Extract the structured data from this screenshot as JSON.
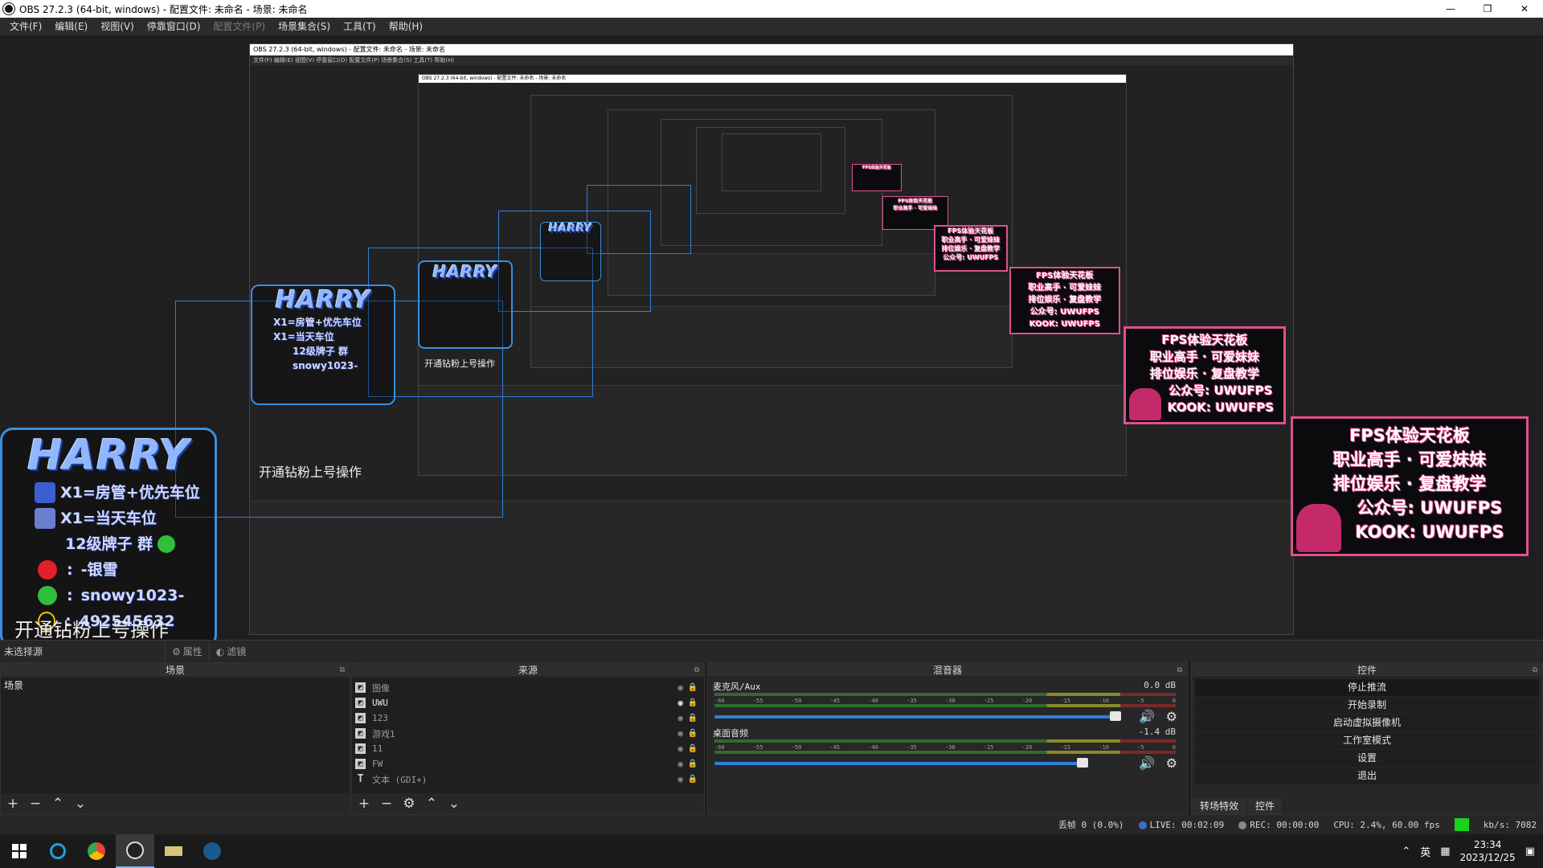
{
  "window": {
    "title": "OBS 27.2.3 (64-bit, windows) - 配置文件: 未命名 - 场景: 未命名",
    "minimize": "—",
    "maximize": "❐",
    "close": "✕"
  },
  "menu": [
    "文件(F)",
    "编辑(E)",
    "视图(V)",
    "停靠窗口(D)",
    "配置文件(P)",
    "场景集合(S)",
    "工具(T)",
    "帮助(H)"
  ],
  "overlay": {
    "logo": "HARRY",
    "rows": [
      "X1=房管+优先车位",
      "X1=当天车位",
      "12级牌子 群",
      "-银雪",
      "snowy1023-",
      "492545632"
    ],
    "caption": "开通钻粉上号操作"
  },
  "banner": {
    "lines": [
      "FPS体验天花板",
      "职业高手 · 可爱妹妹",
      "排位娱乐 · 复盘教学",
      "公众号: UWUFPS",
      "KOOK: UWUFPS"
    ]
  },
  "source_bar": {
    "no_source": "未选择源",
    "properties": "属性",
    "filters": "滤镜"
  },
  "scenes": {
    "title": "场景",
    "items": [
      "场景"
    ]
  },
  "sources": {
    "title": "来源",
    "items": [
      {
        "name": "图像",
        "type": "image"
      },
      {
        "name": "UWU",
        "type": "image"
      },
      {
        "name": "123",
        "type": "image"
      },
      {
        "name": "游戏1",
        "type": "image"
      },
      {
        "name": "11",
        "type": "image"
      },
      {
        "name": "FW",
        "type": "image"
      },
      {
        "name": "文本 (GDI+)",
        "type": "text"
      }
    ]
  },
  "mixer": {
    "title": "混音器",
    "channels": [
      {
        "name": "麦克风/Aux",
        "db": "0.0 dB",
        "volume": 0.96
      },
      {
        "name": "桌面音频",
        "db": "-1.4 dB",
        "volume": 0.88
      }
    ],
    "ticks": [
      "-60",
      "-55",
      "-50",
      "-45",
      "-40",
      "-35",
      "-30",
      "-25",
      "-20",
      "-15",
      "-10",
      "-5",
      "0"
    ]
  },
  "controls": {
    "title": "控件",
    "buttons": [
      "停止推流",
      "开始录制",
      "启动虚拟摄像机",
      "工作室模式",
      "设置",
      "退出"
    ],
    "tabs": [
      "转场特效",
      "控件"
    ]
  },
  "status": {
    "dropped": "丢帧 0 (0.0%)",
    "live": "LIVE: 00:02:09",
    "rec": "REC: 00:00:00",
    "cpu": "CPU: 2.4%, 60.00 fps",
    "kbs": "kb/s: 7082"
  },
  "taskbar": {
    "ime": "英",
    "time": "23:34",
    "date": "2023/12/25"
  },
  "nested_title": "OBS 27.2.3 (64-bit, windows) - 配置文件: 未命名 - 场景: 未命名",
  "nested_menu": "文件(F)  编辑(E)  视图(V)  停靠窗口(D)  配置文件(P)  场景集合(S)  工具(T)  帮助(H)"
}
